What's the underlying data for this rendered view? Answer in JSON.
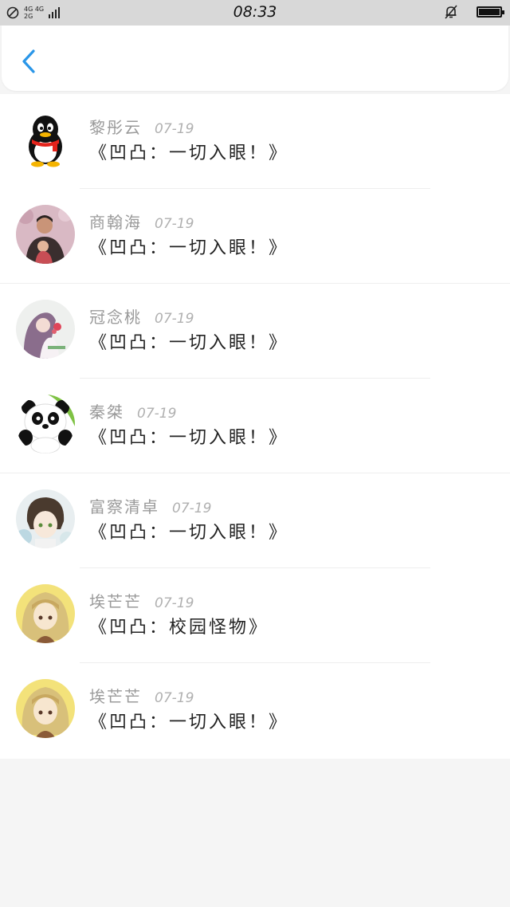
{
  "status_bar": {
    "network_top": "4G 4G",
    "network_bottom": "2G",
    "time": "08:33",
    "icons": [
      "no-sim-icon",
      "signal-icon",
      "mute-bell-icon",
      "battery-icon"
    ]
  },
  "header": {
    "back_icon": "chevron-left-icon",
    "accent_color": "#2a96e8"
  },
  "items": [
    {
      "name": "黎彤云",
      "date": "07-19",
      "title": "《凹凸：一切入眼！》",
      "avatar": "qq-penguin"
    },
    {
      "name": "商翰海",
      "date": "07-19",
      "title": "《凹凸：一切入眼！》",
      "avatar": "photo-man-child"
    },
    {
      "name": "冠念桃",
      "date": "07-19",
      "title": "《凹凸：一切入眼！》",
      "avatar": "illustrated-girl"
    },
    {
      "name": "秦桀",
      "date": "07-19",
      "title": "《凹凸：一切入眼！》",
      "avatar": "panda"
    },
    {
      "name": "富察清卓",
      "date": "07-19",
      "title": "《凹凸：一切入眼！》",
      "avatar": "anime-boy"
    },
    {
      "name": "埃芒芒",
      "date": "07-19",
      "title": "《凹凸：校园怪物》",
      "avatar": "anime-blonde-girl"
    },
    {
      "name": "埃芒芒",
      "date": "07-19",
      "title": "《凹凸：一切入眼！》",
      "avatar": "anime-blonde-girl"
    }
  ]
}
